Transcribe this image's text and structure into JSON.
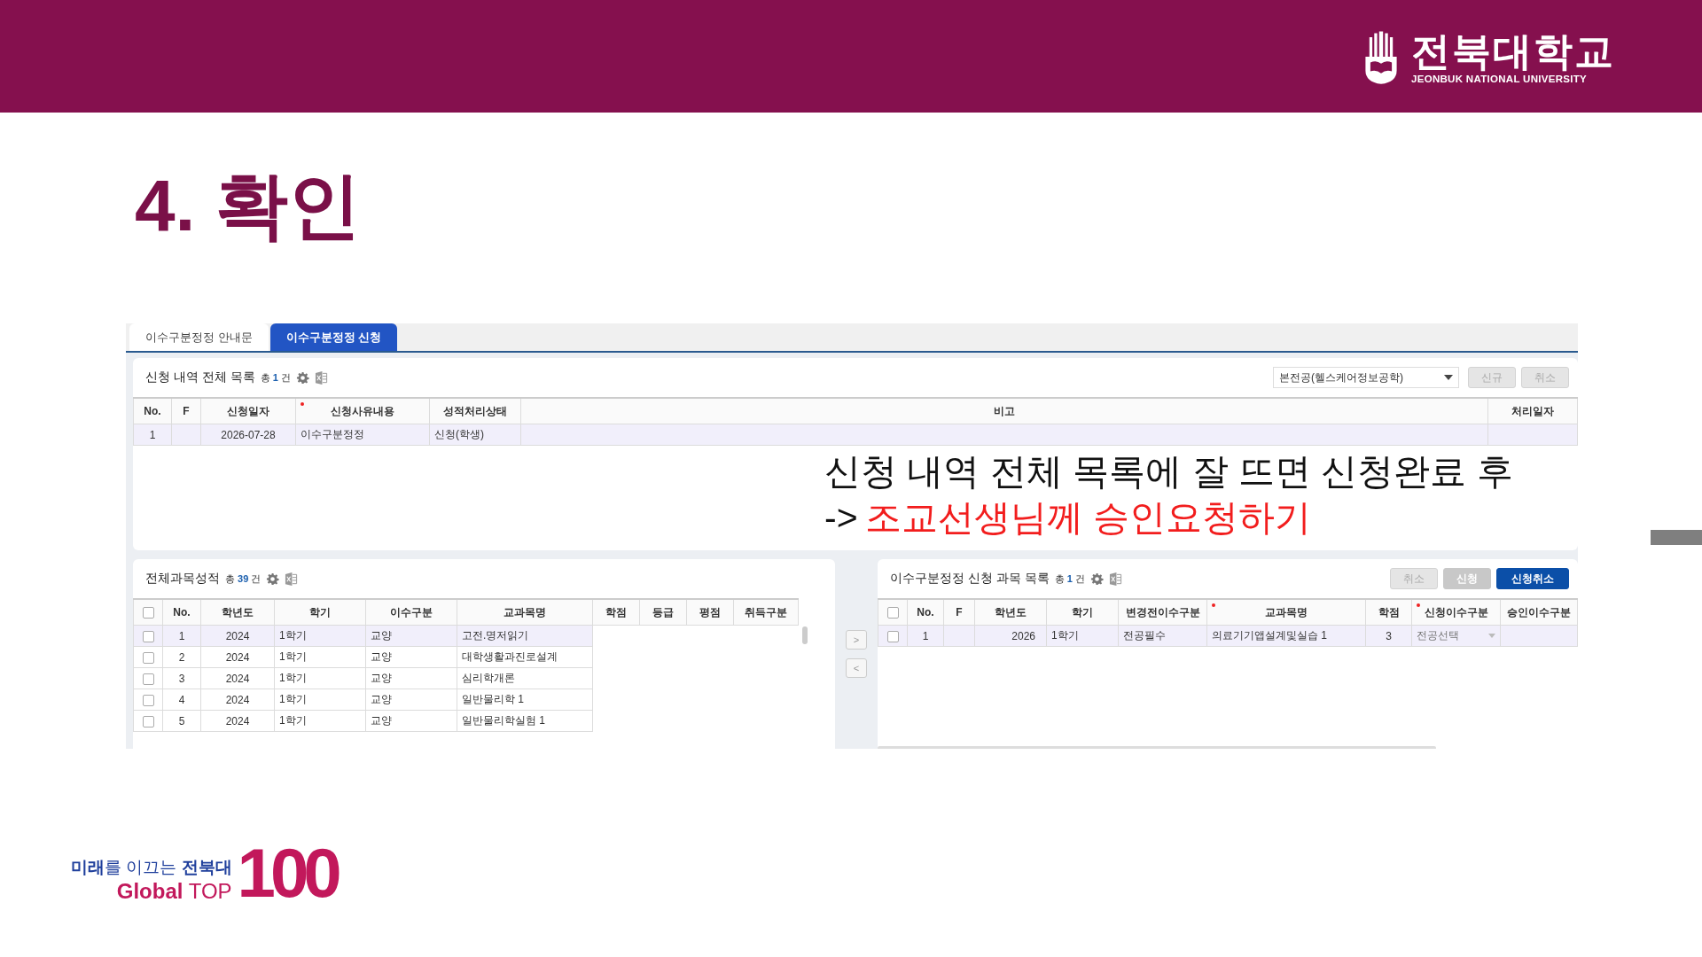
{
  "header": {
    "logo_name": "전북대학교",
    "logo_sub": "JEONBUK NATIONAL UNIVERSITY"
  },
  "slide_title": "4. 확인",
  "tabs": [
    {
      "label": "이수구분정정 안내문",
      "selected": false
    },
    {
      "label": "이수구분정정 신청",
      "selected": true
    }
  ],
  "application_list": {
    "title": "신청 내역 전체 목록",
    "total_label": "총",
    "count": "1",
    "unit": "건",
    "dropdown_value": "본전공(헬스케어정보공학)",
    "buttons": [
      {
        "label": "신규",
        "kind": "light"
      },
      {
        "label": "취소",
        "kind": "light"
      }
    ],
    "columns": [
      {
        "label": "No.",
        "required": false
      },
      {
        "label": "F",
        "required": false
      },
      {
        "label": "신청일자",
        "required": false
      },
      {
        "label": "신청사유내용",
        "required": true
      },
      {
        "label": "성적처리상태",
        "required": false
      },
      {
        "label": "비고",
        "required": false
      },
      {
        "label": "처리일자",
        "required": false
      }
    ],
    "rows": [
      {
        "selected": true,
        "cells": [
          "1",
          "",
          "2026-07-28",
          "이수구분정정",
          "신청(학생)",
          "",
          ""
        ]
      }
    ]
  },
  "annotation": {
    "line1": "신청 내역 전체 목록에 잘 뜨면 신청완료 후",
    "line2_prefix": "->",
    "line2_highlight": "조교선생님께 승인요청하기"
  },
  "grades": {
    "title": "전체과목성적",
    "total_label": "총",
    "count": "39",
    "unit": "건",
    "all_checked": false,
    "columns": [
      {
        "label": "No.",
        "required": false
      },
      {
        "label": "학년도",
        "required": false
      },
      {
        "label": "학기",
        "required": false
      },
      {
        "label": "이수구분",
        "required": false
      },
      {
        "label": "교과목명",
        "required": false
      },
      {
        "label": "학점",
        "required": false
      },
      {
        "label": "등급",
        "required": false
      },
      {
        "label": "평점",
        "required": false
      },
      {
        "label": "취득구분",
        "required": false
      }
    ],
    "rows": [
      {
        "selected": true,
        "checked": false,
        "cells": [
          "1",
          "2024",
          "1학기",
          "교양",
          "고전.명저읽기"
        ]
      },
      {
        "selected": false,
        "checked": false,
        "cells": [
          "2",
          "2024",
          "1학기",
          "교양",
          "대학생활과진로설계"
        ]
      },
      {
        "selected": false,
        "checked": false,
        "cells": [
          "3",
          "2024",
          "1학기",
          "교양",
          "심리학개론"
        ]
      },
      {
        "selected": false,
        "checked": false,
        "cells": [
          "4",
          "2024",
          "1학기",
          "교양",
          "일반물리학 1"
        ]
      },
      {
        "selected": false,
        "checked": false,
        "cells": [
          "5",
          "2024",
          "1학기",
          "교양",
          "일반물리학실험 1"
        ]
      }
    ]
  },
  "move_buttons": [
    ">",
    "<"
  ],
  "course_list": {
    "title": "이수구분정정 신청 과목 목록",
    "total_label": "총",
    "count": "1",
    "unit": "건",
    "all_checked": false,
    "buttons": [
      {
        "label": "취소",
        "kind": "light"
      },
      {
        "label": "신청",
        "kind": "gray"
      },
      {
        "label": "신청취소",
        "kind": "primary"
      }
    ],
    "columns": [
      {
        "label": "No.",
        "required": false
      },
      {
        "label": "F",
        "required": false
      },
      {
        "label": "학년도",
        "required": false
      },
      {
        "label": "학기",
        "required": false
      },
      {
        "label": "변경전이수구분",
        "required": false
      },
      {
        "label": "교과목명",
        "required": true
      },
      {
        "label": "학점",
        "required": false
      },
      {
        "label": "신청이수구분",
        "required": true
      },
      {
        "label": "승인이수구분",
        "required": false
      }
    ],
    "rows": [
      {
        "selected": true,
        "checked": false,
        "cells": [
          "1",
          "",
          "2026",
          "1학기",
          "전공필수",
          "의료기기앱설계및실습 1",
          "3",
          "전공선택",
          ""
        ]
      }
    ]
  },
  "footer_logo": {
    "slogan": "**미래**를 이끄는 **전북대**",
    "tagline": "**Global** TOP",
    "number": "100"
  }
}
